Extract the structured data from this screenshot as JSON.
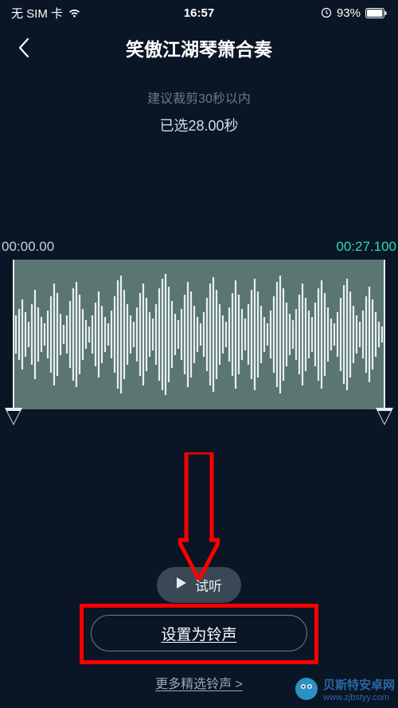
{
  "status": {
    "sim": "无 SIM 卡",
    "time": "16:57",
    "battery_pct": "93%"
  },
  "header": {
    "title": "笑傲江湖琴箫合奏"
  },
  "trim": {
    "hint": "建议裁剪30秒以内",
    "selected": "已选28.00秒"
  },
  "timeline": {
    "start": "00:00.00",
    "end": "00:27.100"
  },
  "buttons": {
    "preview": "试听",
    "set_ringtone": "设置为铃声",
    "more_ringtones": "更多精选铃声 >"
  },
  "watermark": {
    "zh": "贝斯特安卓网",
    "url": "www.zjbstyy.com"
  }
}
